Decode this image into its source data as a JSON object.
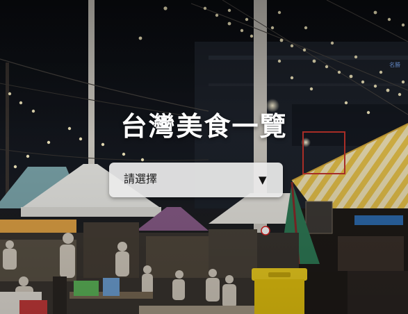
{
  "hero": {
    "title": "台灣美食一覽",
    "background_image": "night-market-photo"
  },
  "filter": {
    "selected_label": "請選擇",
    "arrow_icon": "▼"
  },
  "colors": {
    "title_text": "#ffffff",
    "select_background": "#ebebeb",
    "select_text": "#1a1a1a"
  }
}
